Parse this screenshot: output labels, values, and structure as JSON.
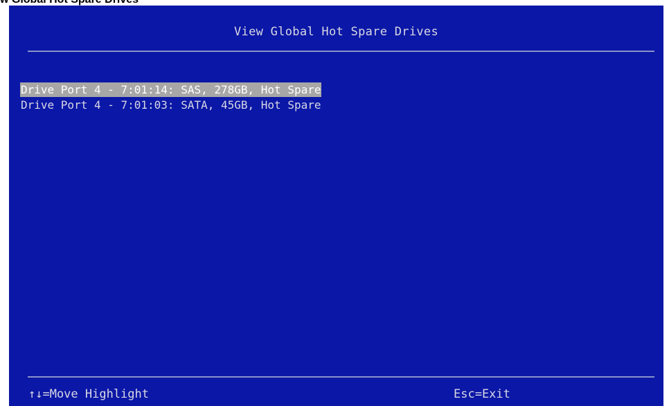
{
  "caption": "w Global Hot Spare Drives",
  "screen": {
    "title": "View Global Hot Spare Drives",
    "drives": [
      {
        "label": "Drive Port 4 - 7:01:14: SAS, 278GB, Hot Spare",
        "selected": true
      },
      {
        "label": "Drive Port 4 - 7:01:03: SATA, 45GB, Hot Spare",
        "selected": false
      }
    ],
    "footer": {
      "move_hint": "↑↓=Move Highlight",
      "exit_hint": "Esc=Exit"
    }
  },
  "colors": {
    "background": "#0b17a6",
    "text": "#d8d8e4",
    "highlight": "#a7a7a7",
    "rule": "#8a93c9"
  }
}
